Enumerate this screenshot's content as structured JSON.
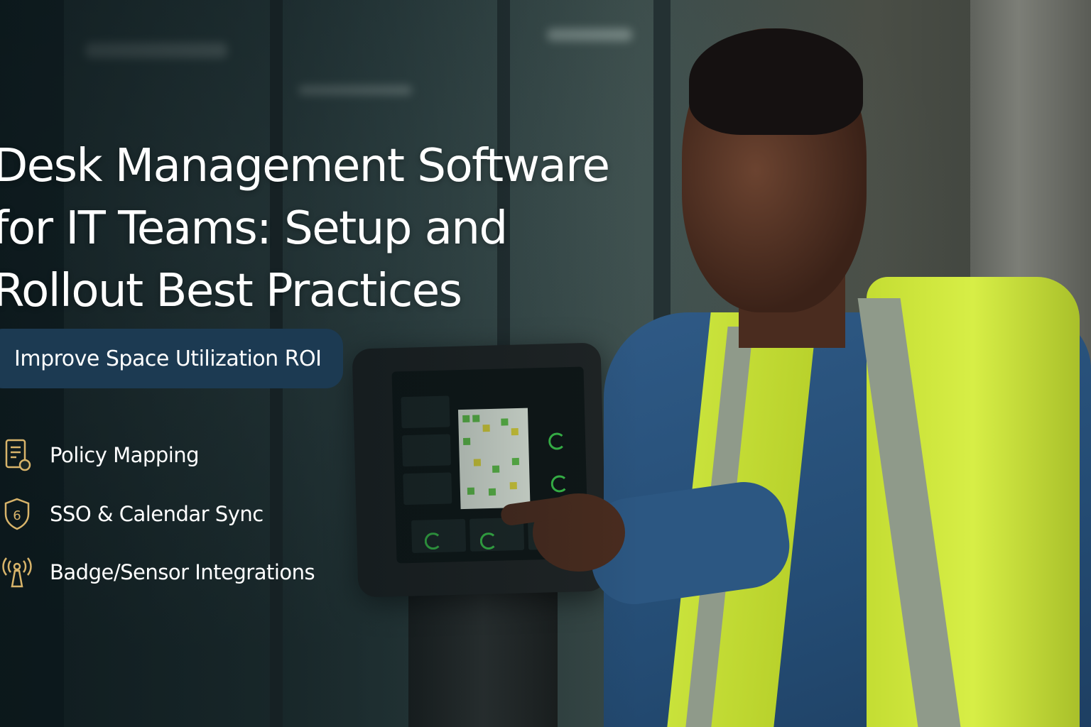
{
  "headline": {
    "line1": "Desk Management Software",
    "line2": "for IT Teams: Setup and",
    "line3": "Rollout Best Practices"
  },
  "cta_pill": {
    "label": "Improve Space Utilization ROI"
  },
  "features": [
    {
      "icon": "document-checklist-icon",
      "label": "Policy Mapping"
    },
    {
      "icon": "shield-icon",
      "icon_text": "6",
      "label": "SSO & Calendar Sync"
    },
    {
      "icon": "wireless-sensor-icon",
      "label": "Badge/Sensor Integrations"
    }
  ],
  "colors": {
    "pill_bg": "#1c3a52",
    "icon_gold": "#d8b46a",
    "text": "#ffffff",
    "screen_accent": "#3ac04a",
    "vest": "#c9e23b"
  }
}
